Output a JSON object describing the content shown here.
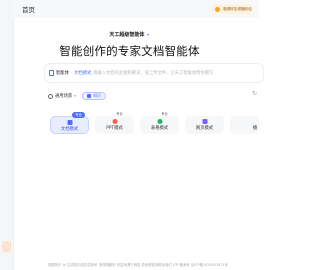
{
  "header": {
    "home_label": "首页",
    "promo_text": "邀请好友领福利包"
  },
  "brand": {
    "name": "天工超级智能体"
  },
  "headline": "智能创作的专家文档智能体",
  "composer": {
    "chip_label": "智能体",
    "chip_sep": "·",
    "chip_mode": "文档模式",
    "placeholder": "请输入文档的主题和要求，或上传文件，让天工智能体帮你撰写"
  },
  "toolbar": {
    "scope_label": "通用场景",
    "kb_label": "知识"
  },
  "modes": [
    {
      "label": "文档模式",
      "badge": "专业"
    },
    {
      "label": "PPT模式",
      "badge": "专业"
    },
    {
      "label": "表格模式",
      "badge": "专业"
    },
    {
      "label": "网页模式",
      "badge": ""
    },
    {
      "label": "播",
      "badge": ""
    }
  ],
  "footer": "如图所示 AI 生成的内容仅供参考 请谨慎甄别 内容来源于网络 若有侵权请联系我们 ICP 备案号 京ICP备2024051671号"
}
